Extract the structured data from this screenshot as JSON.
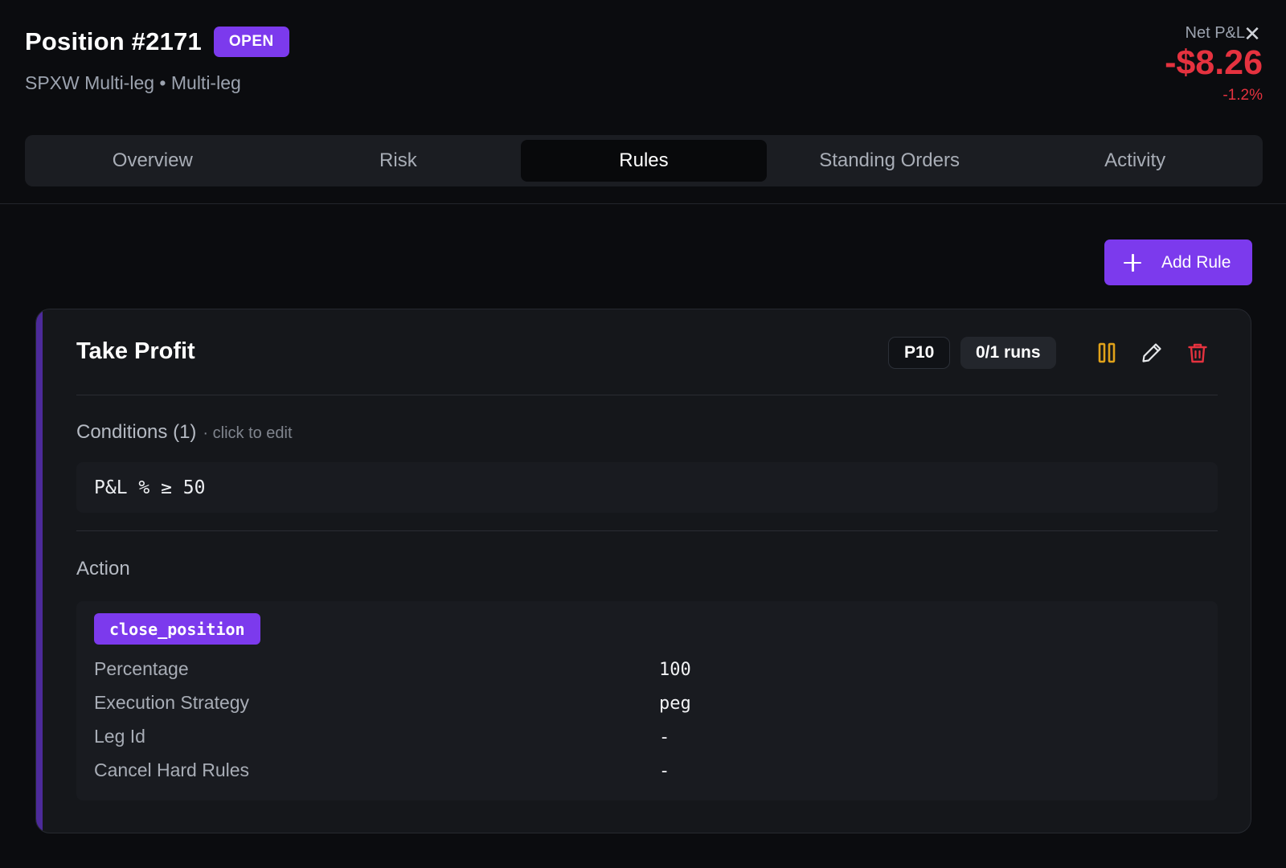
{
  "header": {
    "title": "Position #2171",
    "status": "OPEN",
    "subtitle": "SPXW Multi-leg • Multi-leg",
    "net_pnl_label": "Net P&L",
    "net_pnl_value": "-$8.26",
    "net_pnl_pct": "-1.2%",
    "close_glyph": "✕"
  },
  "tabs": [
    {
      "label": "Overview",
      "active": false
    },
    {
      "label": "Risk",
      "active": false
    },
    {
      "label": "Rules",
      "active": true
    },
    {
      "label": "Standing Orders",
      "active": false
    },
    {
      "label": "Activity",
      "active": false
    }
  ],
  "toolbar": {
    "add_rule_label": "Add Rule"
  },
  "rule": {
    "name": "Take Profit",
    "priority": "P10",
    "runs": "0/1 runs",
    "conditions_label": "Conditions (1)",
    "conditions_hint": "· click to edit",
    "condition": "P&L % ≥ 50",
    "action_label": "Action",
    "action_type": "close_position",
    "params": [
      {
        "key": "Percentage",
        "value": "100"
      },
      {
        "key": "Execution Strategy",
        "value": "peg"
      },
      {
        "key": "Leg Id",
        "value": "-"
      },
      {
        "key": "Cancel Hard Rules",
        "value": "-"
      }
    ]
  },
  "colors": {
    "accent": "#7c3aed",
    "negative": "#e5323f",
    "pause": "#e0a21a",
    "delete": "#e5323f"
  }
}
